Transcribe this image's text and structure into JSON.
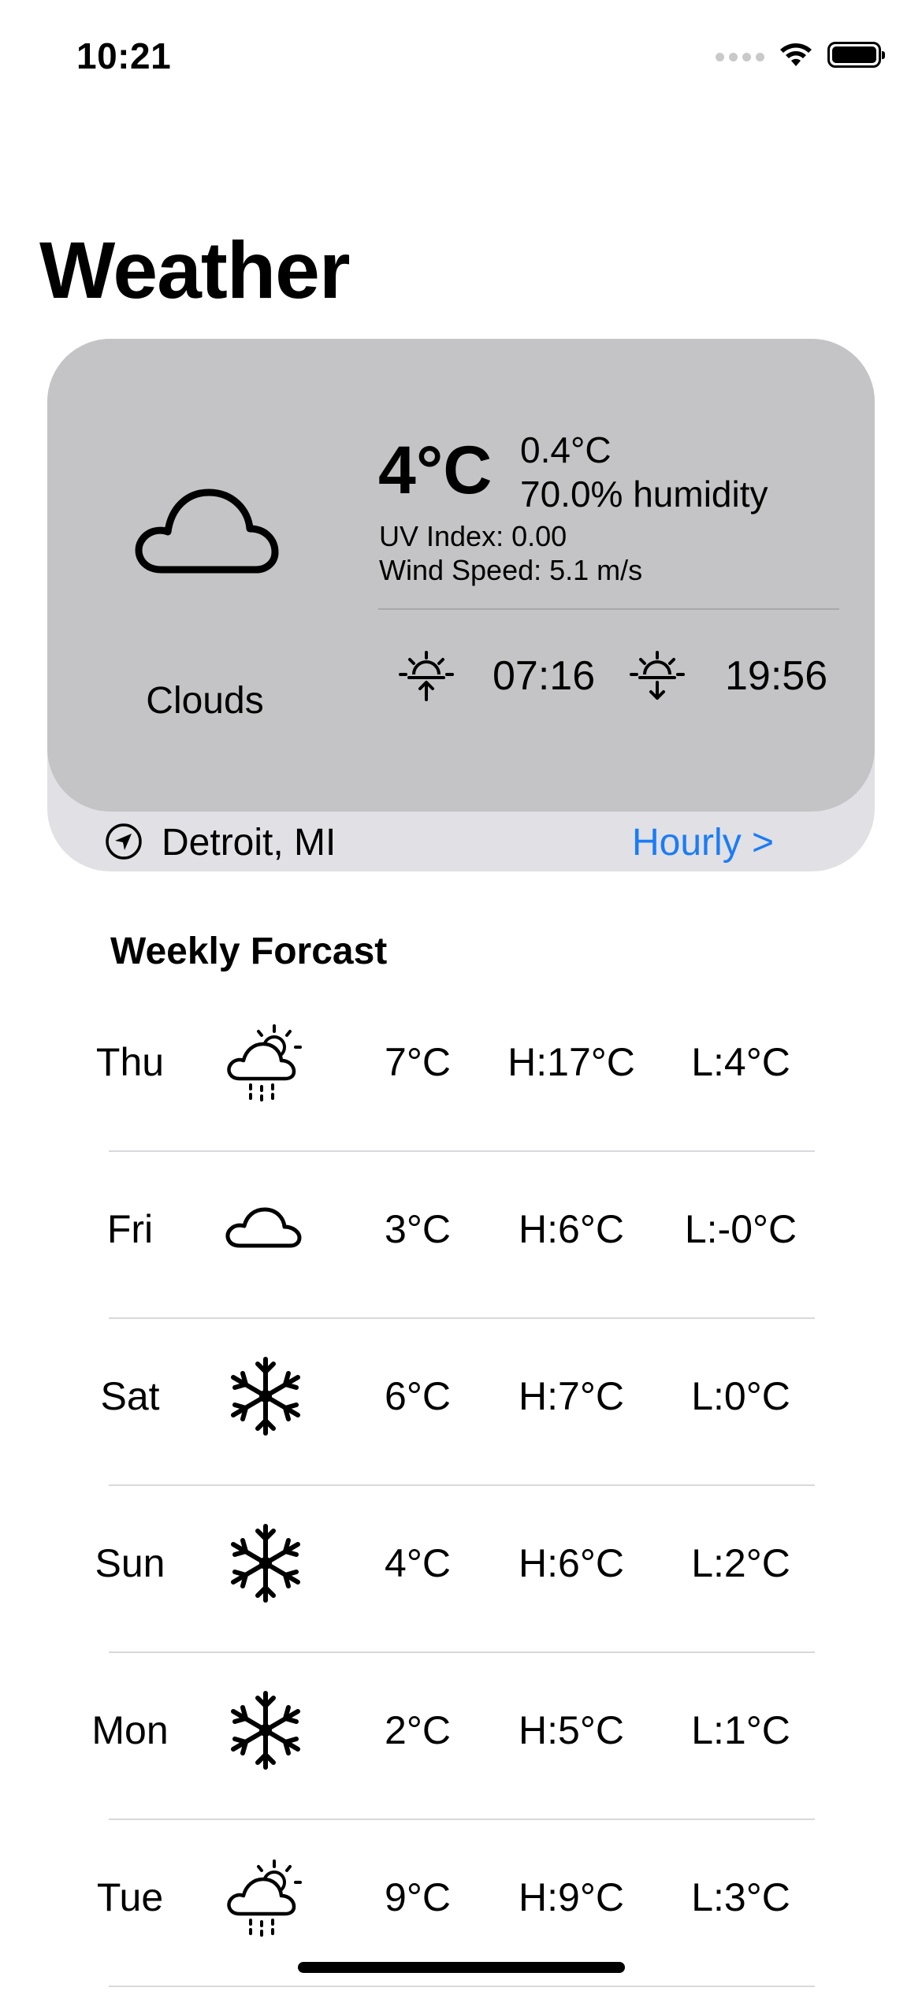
{
  "status_bar": {
    "time": "10:21"
  },
  "page_title": "Weather",
  "current": {
    "icon": "cloud-icon",
    "condition": "Clouds",
    "temperature": "4°C",
    "feels_like": "0.4°C",
    "humidity": "70.0% humidity",
    "uv_index": "UV Index: 0.00",
    "wind_speed": "Wind Speed: 5.1 m/s",
    "sunrise": "07:16",
    "sunset": "19:56",
    "location": "Detroit, MI",
    "hourly_link": "Hourly >"
  },
  "weekly": {
    "title": "Weekly Forcast",
    "days": [
      {
        "day": "Thu",
        "icon": "rain-sun-cloud-icon",
        "temp": "7°C",
        "high": "H:17°C",
        "low": "L:4°C"
      },
      {
        "day": "Fri",
        "icon": "cloud-icon",
        "temp": "3°C",
        "high": "H:6°C",
        "low": "L:-0°C"
      },
      {
        "day": "Sat",
        "icon": "snowflake-icon",
        "temp": "6°C",
        "high": "H:7°C",
        "low": "L:0°C"
      },
      {
        "day": "Sun",
        "icon": "snowflake-icon",
        "temp": "4°C",
        "high": "H:6°C",
        "low": "L:2°C"
      },
      {
        "day": "Mon",
        "icon": "snowflake-icon",
        "temp": "2°C",
        "high": "H:5°C",
        "low": "L:1°C"
      },
      {
        "day": "Tue",
        "icon": "rain-sun-cloud-icon",
        "temp": "9°C",
        "high": "H:9°C",
        "low": "L:3°C"
      }
    ]
  },
  "colors": {
    "card_top": "#c4c4c6",
    "card_bottom": "#e0e0e5",
    "link": "#1b7cf5"
  }
}
